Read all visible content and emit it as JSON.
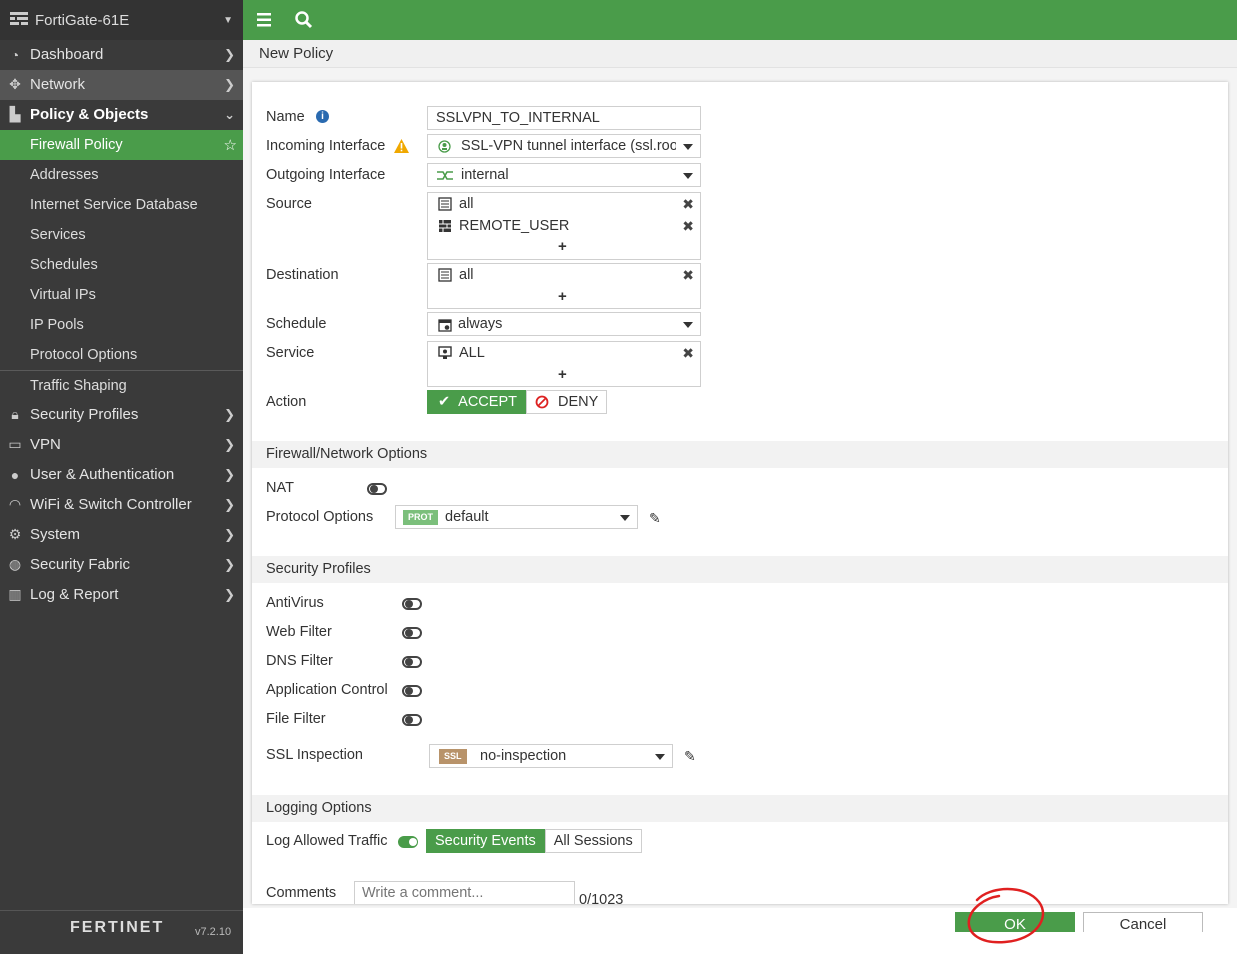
{
  "device": {
    "name": "FortiGate-61E"
  },
  "sidebar": {
    "items": [
      {
        "label": "Dashboard",
        "icon": "dashboard-icon"
      },
      {
        "label": "Network",
        "icon": "network-icon"
      },
      {
        "label": "Policy & Objects",
        "icon": "policy-icon"
      },
      {
        "label": "Security Profiles",
        "icon": "lock-icon"
      },
      {
        "label": "VPN",
        "icon": "laptop-icon"
      },
      {
        "label": "User & Authentication",
        "icon": "user-icon"
      },
      {
        "label": "WiFi & Switch Controller",
        "icon": "wifi-icon"
      },
      {
        "label": "System",
        "icon": "gear-icon"
      },
      {
        "label": "Security Fabric",
        "icon": "fabric-icon"
      },
      {
        "label": "Log & Report",
        "icon": "chart-icon"
      }
    ],
    "sub_items": [
      "Firewall Policy",
      "Addresses",
      "Internet Service Database",
      "Services",
      "Schedules",
      "Virtual IPs",
      "IP Pools",
      "Protocol Options",
      "Traffic Shaping"
    ],
    "footer_logo": "FERTINET",
    "footer_version": "v7.2.10"
  },
  "page": {
    "title": "New Policy"
  },
  "form": {
    "name_label": "Name",
    "name_value": "SSLVPN_TO_INTERNAL",
    "incoming_label": "Incoming Interface",
    "incoming_value": "SSL-VPN tunnel interface (ssl.roo",
    "outgoing_label": "Outgoing Interface",
    "outgoing_value": "internal",
    "source_label": "Source",
    "source_items": [
      "all",
      "REMOTE_USER"
    ],
    "destination_label": "Destination",
    "destination_items": [
      "all"
    ],
    "schedule_label": "Schedule",
    "schedule_value": "always",
    "service_label": "Service",
    "service_items": [
      "ALL"
    ],
    "action_label": "Action",
    "action_accept": "ACCEPT",
    "action_deny": "DENY",
    "add_symbol": "+",
    "remove_symbol": "✖"
  },
  "firewall": {
    "header": "Firewall/Network Options",
    "nat_label": "NAT",
    "nat_enabled": false,
    "protocol_label": "Protocol Options",
    "protocol_badge": "PROT",
    "protocol_value": "default"
  },
  "security": {
    "header": "Security Profiles",
    "profiles": [
      "AntiVirus",
      "Web Filter",
      "DNS Filter",
      "Application Control",
      "File Filter"
    ],
    "ssl_label": "SSL Inspection",
    "ssl_badge": "SSL",
    "ssl_value": "no-inspection"
  },
  "logging": {
    "header": "Logging Options",
    "log_label": "Log Allowed Traffic",
    "log_enabled": true,
    "opt_security": "Security Events",
    "opt_all": "All Sessions",
    "comments_label": "Comments",
    "comments_placeholder": "Write a comment...",
    "comments_count": "0/1023"
  },
  "buttons": {
    "ok": "OK",
    "cancel": "Cancel"
  },
  "colors": {
    "accent": "#4a9c4a",
    "sidebar": "#3a3a3a",
    "annotation": "#e02020"
  }
}
